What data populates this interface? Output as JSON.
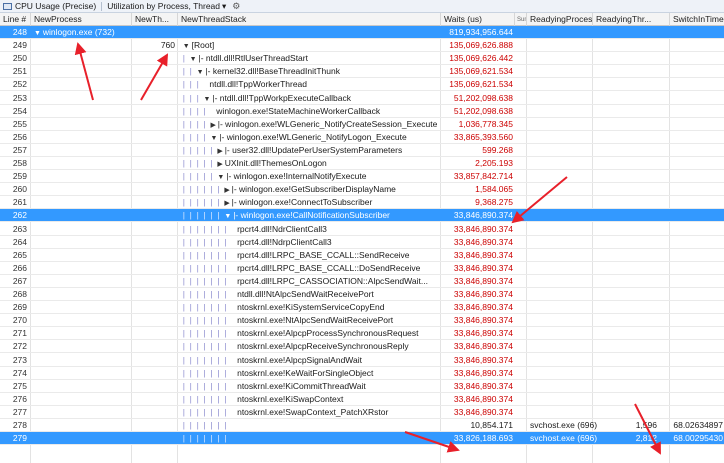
{
  "toolbar": {
    "view_title": "CPU Usage (Precise)",
    "preset": "Utilization by Process, Thread",
    "preset_suffix": "▾"
  },
  "columns": {
    "line": "Line #",
    "process": "NewProcess",
    "thread": "NewTh...",
    "stack": "NewThreadStack",
    "waits": "Waits (us)",
    "sum": "Sum",
    "readying_process": "ReadyingProcess",
    "readying_thread": "ReadyingThr...",
    "switch_in": "SwitchInTime..."
  },
  "rows": [
    {
      "line": "248",
      "process": "winlogon.exe (732)",
      "thread": "",
      "stack": "",
      "waits": "819,934,956.644",
      "rp": "",
      "rt": "",
      "sw": "",
      "sel": true,
      "red": false,
      "indent": 0,
      "exp": ""
    },
    {
      "line": "249",
      "process": "",
      "thread": "760",
      "stack": "[Root]",
      "waits": "135,069,626.888",
      "rp": "",
      "rt": "",
      "sw": "",
      "sel": false,
      "red": true,
      "indent": 0,
      "exp": "▼"
    },
    {
      "line": "250",
      "process": "",
      "thread": "",
      "stack": "|- ntdll.dll!RtlUserThreadStart",
      "waits": "135,069,626.442",
      "rp": "",
      "rt": "",
      "sw": "",
      "sel": false,
      "red": true,
      "indent": 1,
      "exp": "▼"
    },
    {
      "line": "251",
      "process": "",
      "thread": "",
      "stack": "|- kernel32.dll!BaseThreadInitThunk",
      "waits": "135,069,621.534",
      "rp": "",
      "rt": "",
      "sw": "",
      "sel": false,
      "red": true,
      "indent": 2,
      "exp": "▼"
    },
    {
      "line": "252",
      "process": "",
      "thread": "",
      "stack": "ntdll.dll!TppWorkerThread",
      "waits": "135,069,621.534",
      "rp": "",
      "rt": "",
      "sw": "",
      "sel": false,
      "red": true,
      "indent": 3,
      "exp": ""
    },
    {
      "line": "253",
      "process": "",
      "thread": "",
      "stack": "|- ntdll.dll!TppWorkpExecuteCallback",
      "waits": "51,202,098.638",
      "rp": "",
      "rt": "",
      "sw": "",
      "sel": false,
      "red": true,
      "indent": 3,
      "exp": "▼"
    },
    {
      "line": "254",
      "process": "",
      "thread": "",
      "stack": "winlogon.exe!StateMachineWorkerCallback",
      "waits": "51,202,098.638",
      "rp": "",
      "rt": "",
      "sw": "",
      "sel": false,
      "red": true,
      "indent": 4,
      "exp": ""
    },
    {
      "line": "255",
      "process": "",
      "thread": "",
      "stack": "|- winlogon.exe!WLGeneric_NotifyCreateSession_Execute",
      "waits": "1,036,778.345",
      "rp": "",
      "rt": "",
      "sw": "",
      "sel": false,
      "red": true,
      "indent": 4,
      "exp": "▶"
    },
    {
      "line": "256",
      "process": "",
      "thread": "",
      "stack": "|- winlogon.exe!WLGeneric_NotifyLogon_Execute",
      "waits": "33,865,393.560",
      "rp": "",
      "rt": "",
      "sw": "",
      "sel": false,
      "red": true,
      "indent": 4,
      "exp": "▼"
    },
    {
      "line": "257",
      "process": "",
      "thread": "",
      "stack": "|- user32.dll!UpdatePerUserSystemParameters",
      "waits": "599.268",
      "rp": "",
      "rt": "",
      "sw": "",
      "sel": false,
      "red": true,
      "indent": 5,
      "exp": "▶"
    },
    {
      "line": "258",
      "process": "",
      "thread": "",
      "stack": "UXInit.dll!ThemesOnLogon",
      "waits": "2,205.193",
      "rp": "",
      "rt": "",
      "sw": "",
      "sel": false,
      "red": true,
      "indent": 5,
      "exp": "▶"
    },
    {
      "line": "259",
      "process": "",
      "thread": "",
      "stack": "|- winlogon.exe!InternalNotifyExecute",
      "waits": "33,857,842.714",
      "rp": "",
      "rt": "",
      "sw": "",
      "sel": false,
      "red": true,
      "indent": 5,
      "exp": "▼"
    },
    {
      "line": "260",
      "process": "",
      "thread": "",
      "stack": "|- winlogon.exe!GetSubscriberDisplayName",
      "waits": "1,584.065",
      "rp": "",
      "rt": "",
      "sw": "",
      "sel": false,
      "red": true,
      "indent": 6,
      "exp": "▶"
    },
    {
      "line": "261",
      "process": "",
      "thread": "",
      "stack": "|- winlogon.exe!ConnectToSubscriber",
      "waits": "9,368.275",
      "rp": "",
      "rt": "",
      "sw": "",
      "sel": false,
      "red": true,
      "indent": 6,
      "exp": "▶"
    },
    {
      "line": "262",
      "process": "",
      "thread": "",
      "stack": "|- winlogon.exe!CallNotificationSubscriber",
      "waits": "33,846,890.374",
      "rp": "",
      "rt": "",
      "sw": "",
      "sel": true,
      "red": false,
      "indent": 6,
      "exp": "▼"
    },
    {
      "line": "263",
      "process": "",
      "thread": "",
      "stack": "rpcrt4.dll!NdrClientCall3",
      "waits": "33,846,890.374",
      "rp": "",
      "rt": "",
      "sw": "",
      "sel": false,
      "red": true,
      "indent": 7,
      "exp": ""
    },
    {
      "line": "264",
      "process": "",
      "thread": "",
      "stack": "rpcrt4.dll!NdrpClientCall3",
      "waits": "33,846,890.374",
      "rp": "",
      "rt": "",
      "sw": "",
      "sel": false,
      "red": true,
      "indent": 7,
      "exp": ""
    },
    {
      "line": "265",
      "process": "",
      "thread": "",
      "stack": "rpcrt4.dll!LRPC_BASE_CCALL::SendReceive",
      "waits": "33,846,890.374",
      "rp": "",
      "rt": "",
      "sw": "",
      "sel": false,
      "red": true,
      "indent": 7,
      "exp": ""
    },
    {
      "line": "266",
      "process": "",
      "thread": "",
      "stack": "rpcrt4.dll!LRPC_BASE_CCALL::DoSendReceive",
      "waits": "33,846,890.374",
      "rp": "",
      "rt": "",
      "sw": "",
      "sel": false,
      "red": true,
      "indent": 7,
      "exp": ""
    },
    {
      "line": "267",
      "process": "",
      "thread": "",
      "stack": "rpcrt4.dll!LRPC_CASSOCIATION::AlpcSendWait...",
      "waits": "33,846,890.374",
      "rp": "",
      "rt": "",
      "sw": "",
      "sel": false,
      "red": true,
      "indent": 7,
      "exp": ""
    },
    {
      "line": "268",
      "process": "",
      "thread": "",
      "stack": "ntdll.dll!NtAlpcSendWaitReceivePort",
      "waits": "33,846,890.374",
      "rp": "",
      "rt": "",
      "sw": "",
      "sel": false,
      "red": true,
      "indent": 7,
      "exp": ""
    },
    {
      "line": "269",
      "process": "",
      "thread": "",
      "stack": "ntoskrnl.exe!KiSystemServiceCopyEnd",
      "waits": "33,846,890.374",
      "rp": "",
      "rt": "",
      "sw": "",
      "sel": false,
      "red": true,
      "indent": 7,
      "exp": ""
    },
    {
      "line": "270",
      "process": "",
      "thread": "",
      "stack": "ntoskrnl.exe!NtAlpcSendWaitReceivePort",
      "waits": "33,846,890.374",
      "rp": "",
      "rt": "",
      "sw": "",
      "sel": false,
      "red": true,
      "indent": 7,
      "exp": ""
    },
    {
      "line": "271",
      "process": "",
      "thread": "",
      "stack": "ntoskrnl.exe!AlpcpProcessSynchronousRequest",
      "waits": "33,846,890.374",
      "rp": "",
      "rt": "",
      "sw": "",
      "sel": false,
      "red": true,
      "indent": 7,
      "exp": ""
    },
    {
      "line": "272",
      "process": "",
      "thread": "",
      "stack": "ntoskrnl.exe!AlpcpReceiveSynchronousReply",
      "waits": "33,846,890.374",
      "rp": "",
      "rt": "",
      "sw": "",
      "sel": false,
      "red": true,
      "indent": 7,
      "exp": ""
    },
    {
      "line": "273",
      "process": "",
      "thread": "",
      "stack": "ntoskrnl.exe!AlpcpSignalAndWait",
      "waits": "33,846,890.374",
      "rp": "",
      "rt": "",
      "sw": "",
      "sel": false,
      "red": true,
      "indent": 7,
      "exp": ""
    },
    {
      "line": "274",
      "process": "",
      "thread": "",
      "stack": "ntoskrnl.exe!KeWaitForSingleObject",
      "waits": "33,846,890.374",
      "rp": "",
      "rt": "",
      "sw": "",
      "sel": false,
      "red": true,
      "indent": 7,
      "exp": ""
    },
    {
      "line": "275",
      "process": "",
      "thread": "",
      "stack": "ntoskrnl.exe!KiCommitThreadWait",
      "waits": "33,846,890.374",
      "rp": "",
      "rt": "",
      "sw": "",
      "sel": false,
      "red": true,
      "indent": 7,
      "exp": ""
    },
    {
      "line": "276",
      "process": "",
      "thread": "",
      "stack": "ntoskrnl.exe!KiSwapContext",
      "waits": "33,846,890.374",
      "rp": "",
      "rt": "",
      "sw": "",
      "sel": false,
      "red": true,
      "indent": 7,
      "exp": ""
    },
    {
      "line": "277",
      "process": "",
      "thread": "",
      "stack": "ntoskrnl.exe!SwapContext_PatchXRstor",
      "waits": "33,846,890.374",
      "rp": "",
      "rt": "",
      "sw": "",
      "sel": false,
      "red": true,
      "indent": 7,
      "exp": ""
    },
    {
      "line": "278",
      "process": "",
      "thread": "",
      "stack": "",
      "waits": "10,854.171",
      "rp": "svchost.exe (696)",
      "rt": "1,596",
      "sw": "68.02634897",
      "sel": false,
      "red": false,
      "indent": 7,
      "exp": ""
    },
    {
      "line": "279",
      "process": "",
      "thread": "",
      "stack": "",
      "waits": "33,826,188.693",
      "rp": "svchost.exe (696)",
      "rt": "2,812",
      "sw": "68.00295430",
      "sel": true,
      "red": false,
      "indent": 7,
      "exp": ""
    }
  ],
  "colors": {
    "selection": "#3399ff",
    "hot_value": "#cc0000",
    "annotation_arrow": "#e8202a"
  }
}
